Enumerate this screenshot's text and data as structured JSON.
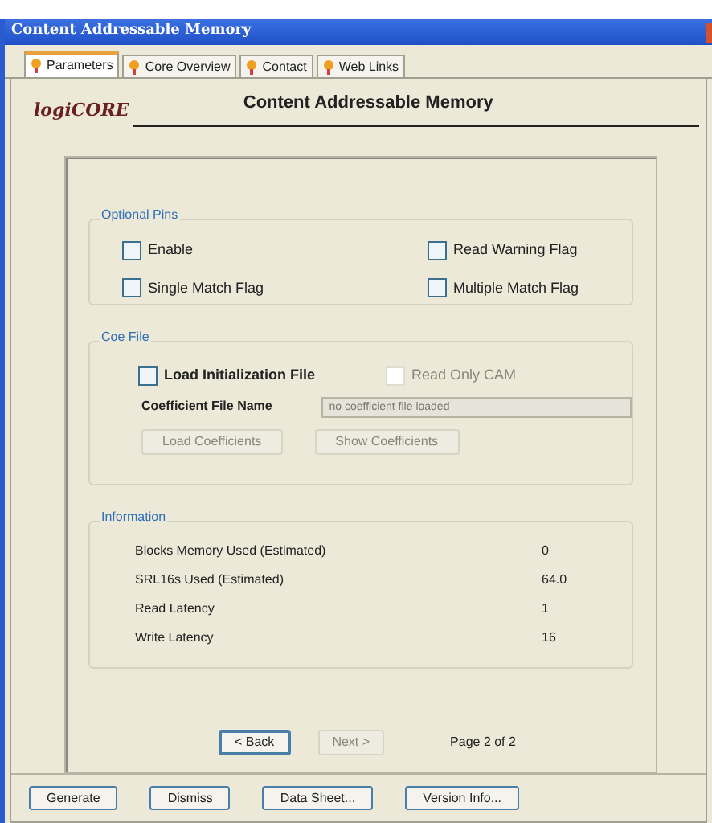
{
  "window": {
    "title": "Content Addressable Memory"
  },
  "tabs": [
    {
      "label": "Parameters",
      "selected": true
    },
    {
      "label": "Core Overview",
      "selected": false
    },
    {
      "label": "Contact",
      "selected": false
    },
    {
      "label": "Web Links",
      "selected": false
    }
  ],
  "header": {
    "logo": "logiCORE",
    "title": "Content Addressable Memory"
  },
  "optional_pins": {
    "title": "Optional Pins",
    "options": [
      {
        "label": "Enable",
        "checked": false
      },
      {
        "label": "Read Warning Flag",
        "checked": false
      },
      {
        "label": "Single Match Flag",
        "checked": false
      },
      {
        "label": "Multiple Match Flag",
        "checked": false
      }
    ]
  },
  "coe_file": {
    "title": "Coe File",
    "load_init": {
      "label": "Load Initialization File",
      "checked": false,
      "disabled": false
    },
    "read_only": {
      "label": "Read Only CAM",
      "checked": false,
      "disabled": true
    },
    "field_label": "Coefficient File Name",
    "field": {
      "placeholder": "no coefficient file loaded",
      "disabled": true
    },
    "buttons": [
      {
        "label": "Load Coefficients",
        "disabled": true
      },
      {
        "label": "Show Coefficients",
        "disabled": true
      }
    ]
  },
  "information": {
    "title": "Information",
    "rows": [
      {
        "label": "Blocks Memory Used (Estimated)",
        "value": "0"
      },
      {
        "label": "SRL16s Used (Estimated)",
        "value": "64.0"
      },
      {
        "label": "Read Latency",
        "value": "1"
      },
      {
        "label": "Write Latency",
        "value": "16"
      }
    ]
  },
  "nav": {
    "back": {
      "label": "< Back",
      "disabled": false
    },
    "next": {
      "label": "Next >",
      "disabled": true
    },
    "page": "Page 2 of 2"
  },
  "footer_buttons": [
    "Generate",
    "Dismiss",
    "Data Sheet...",
    "Version Info..."
  ]
}
